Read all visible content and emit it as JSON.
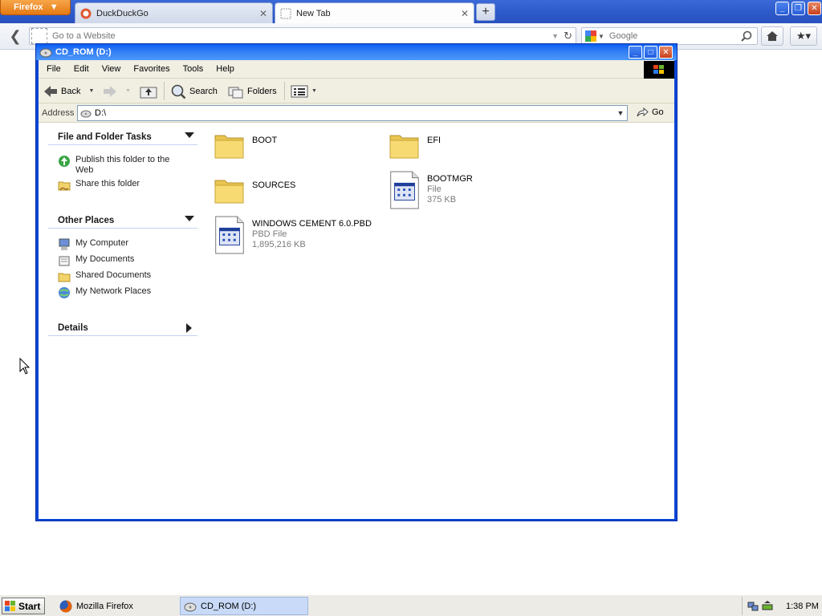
{
  "firefox": {
    "button_label": "Firefox",
    "tabs": [
      {
        "label": "DuckDuckGo"
      },
      {
        "label": "New Tab"
      }
    ],
    "new_tab": "+",
    "url_placeholder": "Go to a Website",
    "search_placeholder": "Google"
  },
  "explorer": {
    "title": "CD_ROM (D:)",
    "menu": [
      "File",
      "Edit",
      "View",
      "Favorites",
      "Tools",
      "Help"
    ],
    "toolbar": {
      "back": "Back",
      "search": "Search",
      "folders": "Folders"
    },
    "address_label": "Address",
    "address_value": "D:\\",
    "go_label": "Go",
    "task_pane": {
      "file_folder_tasks": {
        "title": "File and Folder Tasks",
        "items": [
          "Publish this folder to the Web",
          "Share this folder"
        ]
      },
      "other_places": {
        "title": "Other Places",
        "items": [
          "My Computer",
          "My Documents",
          "Shared Documents",
          "My Network Places"
        ]
      },
      "details": {
        "title": "Details"
      }
    },
    "files": [
      {
        "name": "BOOT",
        "kind": "folder"
      },
      {
        "name": "EFI",
        "kind": "folder"
      },
      {
        "name": "SOURCES",
        "kind": "folder"
      },
      {
        "name": "BOOTMGR",
        "type": "File",
        "size": "375 KB",
        "kind": "file"
      },
      {
        "name": "WINDOWS CEMENT 6.0.PBD",
        "type": "PBD File",
        "size": "1,895,216 KB",
        "kind": "file"
      }
    ]
  },
  "taskbar": {
    "start_label": "Start",
    "tasks": [
      {
        "label": "Mozilla Firefox"
      },
      {
        "label": "CD_ROM (D:)"
      }
    ],
    "clock": "1:38 PM"
  },
  "colors": {
    "xp_blue": "#0a46d6",
    "panel_line": "#c5d3f0",
    "firefox_orange": "#e57a12"
  }
}
